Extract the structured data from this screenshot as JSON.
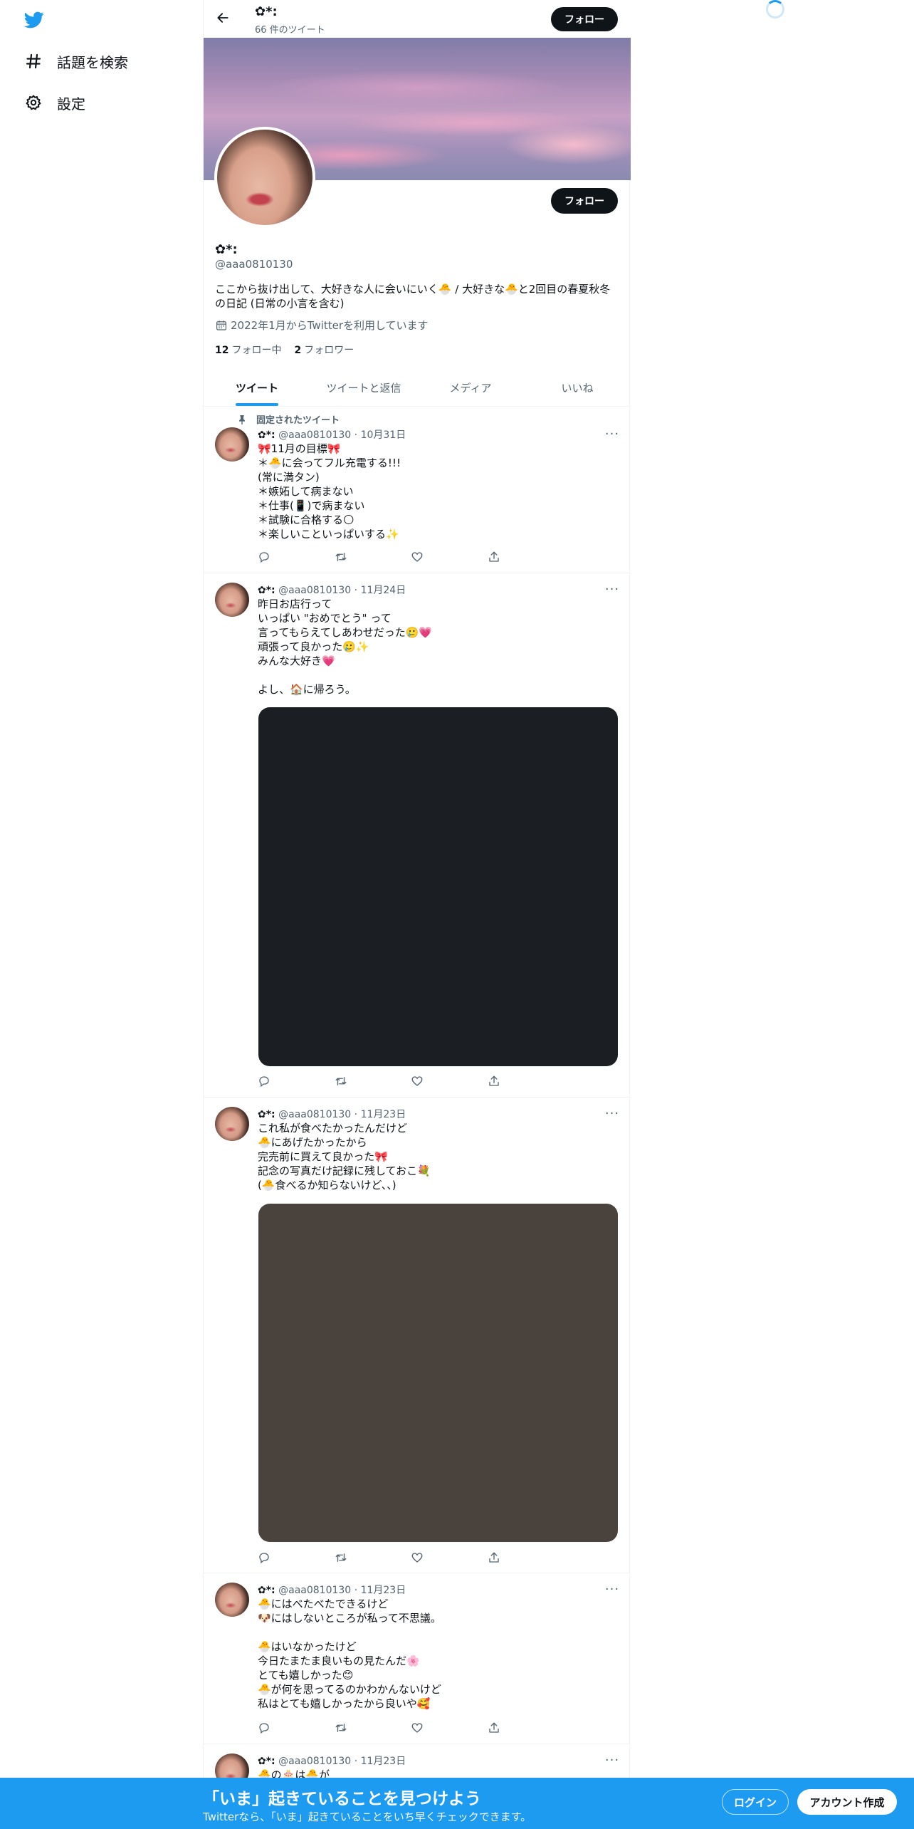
{
  "nav": {
    "explore_label": "話題を検索",
    "settings_label": "設定"
  },
  "topbar": {
    "name": "✿*:",
    "tweet_count": "66 件のツイート",
    "follow_label": "フォロー"
  },
  "profile": {
    "name": "✿*:",
    "handle": "@aaa0810130",
    "bio": "ここから抜け出して、大好きな人に会いにいく🐣 / 大好きな🐣と2回目の春夏秋冬の日記 (日常の小言を含む)",
    "joined": "2022年1月からTwitterを利用しています",
    "following_count": "12",
    "following_label": "フォロー中",
    "followers_count": "2",
    "followers_label": "フォロワー",
    "follow_label": "フォロー"
  },
  "tabs": [
    {
      "label": "ツイート",
      "active": true
    },
    {
      "label": "ツイートと返信",
      "active": false
    },
    {
      "label": "メディア",
      "active": false
    },
    {
      "label": "いいね",
      "active": false
    }
  ],
  "tweets": [
    {
      "pinned_label": "固定されたツイート",
      "name": "✿*:",
      "handle": "@aaa0810130",
      "date": "10月31日",
      "text": "🎀11月の目標🎀\n＊🐣に会ってフル充電する!!!\n(常に満タン)\n＊嫉妬して病まない\n＊仕事(📱)で病まない\n＊試験に合格する🌕\n＊楽しいこといっぱいする✨"
    },
    {
      "name": "✿*:",
      "handle": "@aaa0810130",
      "date": "11月24日",
      "text": "昨日お店行って\nいっぱい \"おめでとう\" って\n言ってもらえてしあわせだった🥲💗\n頑張って良かった🥲✨\nみんな大好き💗\n\nよし、🏠に帰ろう。",
      "media_color": "#1b1f23"
    },
    {
      "name": "✿*:",
      "handle": "@aaa0810130",
      "date": "11月23日",
      "text": "これ私が食べたかったんだけど\n🐣にあげたかったから\n完売前に買えて良かった🎀\n記念の写真だけ記録に残しておこ💐\n(🐣食べるか知らないけど、、)",
      "media_color": "#4a423d"
    },
    {
      "name": "✿*:",
      "handle": "@aaa0810130",
      "date": "11月23日",
      "text": "🐣にはべたべたできるけど\n🐶にはしないところが私って不思議。\n\n🐣はいなかったけど\n今日たまたま良いもの見たんだ🌸\nとても嬉しかった😊\n🐣が何を思ってるのかわかんないけど\n私はとても嬉しかったから良いや🥰"
    },
    {
      "name": "✿*:",
      "handle": "@aaa0810130",
      "date": "11月23日",
      "text": "🐣の🎂は🐣が"
    }
  ],
  "bottom": {
    "title": "「いま」起きていることを見つけよう",
    "subtitle": "Twitterなら、「いま」起きていることをいち早くチェックできます。",
    "login_label": "ログイン",
    "signup_label": "アカウント作成"
  },
  "colors": {
    "accent": "#1d9bf0",
    "text": "#0f1419",
    "muted": "#536471"
  }
}
